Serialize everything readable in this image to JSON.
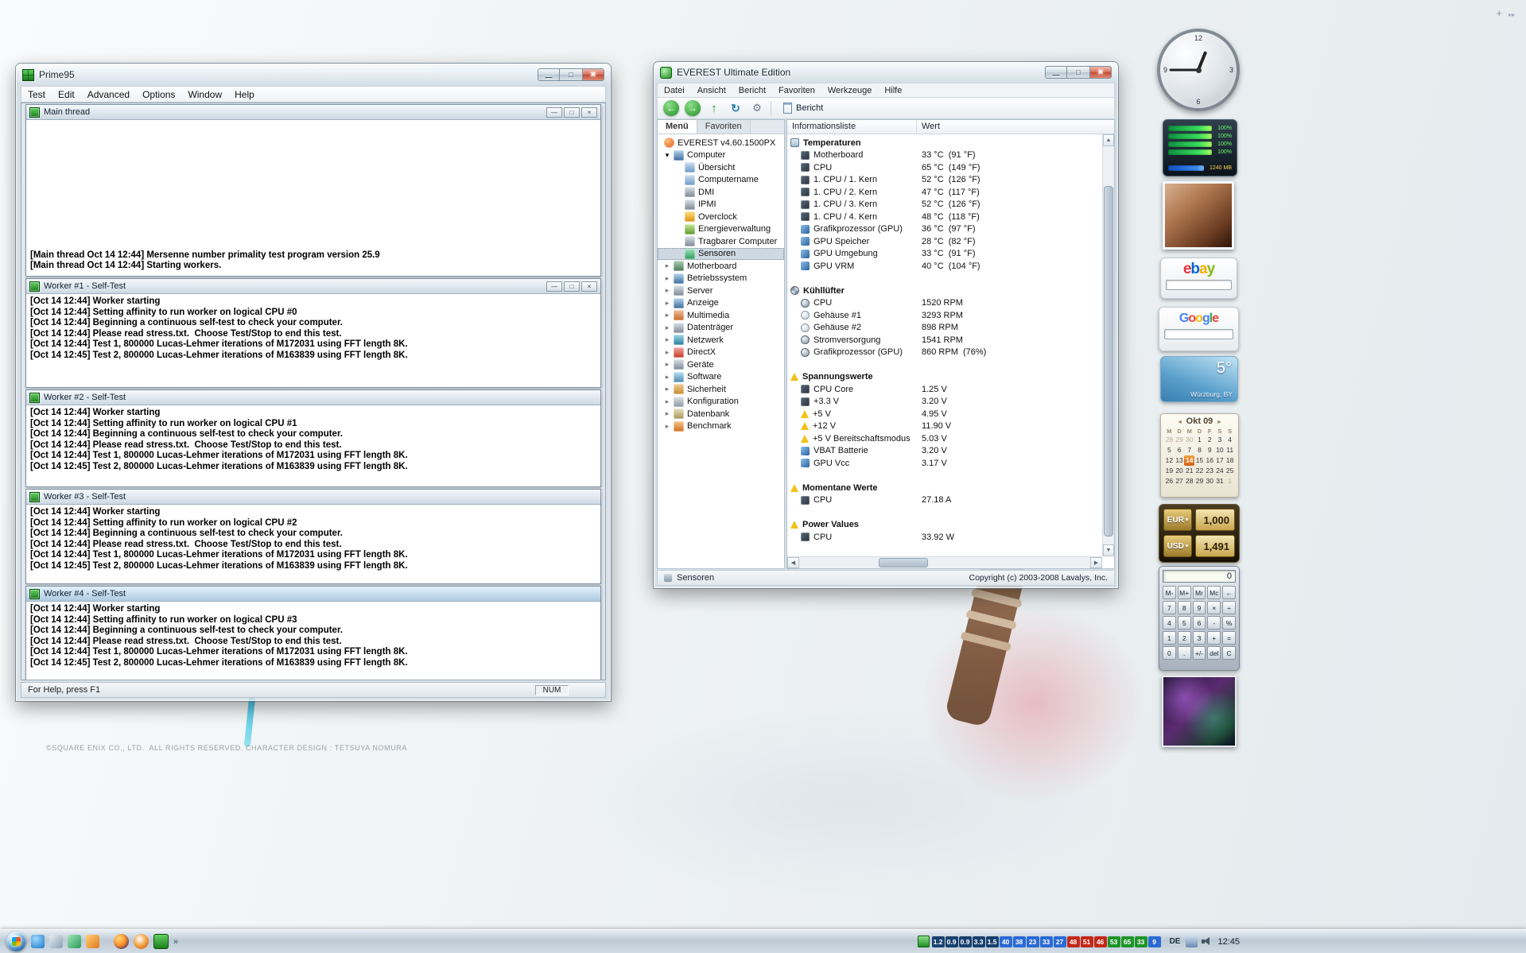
{
  "desktop": {
    "copyright": "©SQUARE ENIX CO., LTD.  ALL RIGHTS RESERVED. CHARACTER DESIGN : TETSUYA NOMURA"
  },
  "prime95": {
    "title": "Prime95",
    "menu": [
      "Test",
      "Edit",
      "Advanced",
      "Options",
      "Window",
      "Help"
    ],
    "status_help": "For Help, press F1",
    "status_num": "NUM",
    "main_thread": {
      "title": "Main thread",
      "lines": [
        "[Main thread Oct 14 12:44] Mersenne number primality test program version 25.9",
        "[Main thread Oct 14 12:44] Starting workers."
      ]
    },
    "worker1": {
      "title": "Worker #1 - Self-Test",
      "lines": [
        "[Oct 14 12:44] Worker starting",
        "[Oct 14 12:44] Setting affinity to run worker on logical CPU #0",
        "[Oct 14 12:44] Beginning a continuous self-test to check your computer.",
        "[Oct 14 12:44] Please read stress.txt.  Choose Test/Stop to end this test.",
        "[Oct 14 12:44] Test 1, 800000 Lucas-Lehmer iterations of M172031 using FFT length 8K.",
        "[Oct 14 12:45] Test 2, 800000 Lucas-Lehmer iterations of M163839 using FFT length 8K."
      ]
    },
    "worker2": {
      "title": "Worker #2 - Self-Test",
      "lines": [
        "[Oct 14 12:44] Worker starting",
        "[Oct 14 12:44] Setting affinity to run worker on logical CPU #1",
        "[Oct 14 12:44] Beginning a continuous self-test to check your computer.",
        "[Oct 14 12:44] Please read stress.txt.  Choose Test/Stop to end this test.",
        "[Oct 14 12:44] Test 1, 800000 Lucas-Lehmer iterations of M172031 using FFT length 8K.",
        "[Oct 14 12:45] Test 2, 800000 Lucas-Lehmer iterations of M163839 using FFT length 8K."
      ]
    },
    "worker3": {
      "title": "Worker #3 - Self-Test",
      "lines": [
        "[Oct 14 12:44] Worker starting",
        "[Oct 14 12:44] Setting affinity to run worker on logical CPU #2",
        "[Oct 14 12:44] Beginning a continuous self-test to check your computer.",
        "[Oct 14 12:44] Please read stress.txt.  Choose Test/Stop to end this test.",
        "[Oct 14 12:44] Test 1, 800000 Lucas-Lehmer iterations of M172031 using FFT length 8K.",
        "[Oct 14 12:45] Test 2, 800000 Lucas-Lehmer iterations of M163839 using FFT length 8K."
      ]
    },
    "worker4": {
      "title": "Worker #4 - Self-Test",
      "lines": [
        "[Oct 14 12:44] Worker starting",
        "[Oct 14 12:44] Setting affinity to run worker on logical CPU #3",
        "[Oct 14 12:44] Beginning a continuous self-test to check your computer.",
        "[Oct 14 12:44] Please read stress.txt.  Choose Test/Stop to end this test.",
        "[Oct 14 12:44] Test 1, 800000 Lucas-Lehmer iterations of M172031 using FFT length 8K.",
        "[Oct 14 12:45] Test 2, 800000 Lucas-Lehmer iterations of M163839 using FFT length 8K."
      ]
    }
  },
  "everest": {
    "title": "EVEREST Ultimate Edition",
    "menu": [
      "Datei",
      "Ansicht",
      "Bericht",
      "Favoriten",
      "Werkzeuge",
      "Hilfe"
    ],
    "report_button": "Bericht",
    "tabs": [
      {
        "label": "Menü",
        "active": true
      },
      {
        "label": "Favoriten",
        "active": false
      }
    ],
    "tree": [
      {
        "label": "EVEREST v4.60.1500PX",
        "icon": "everest-logo",
        "level": 0
      },
      {
        "label": "Computer",
        "icon": "computer",
        "level": 1,
        "arrow": "expanded"
      },
      {
        "label": "Übersicht",
        "icon": "overview",
        "level": 2
      },
      {
        "label": "Computername",
        "icon": "computername",
        "level": 2
      },
      {
        "label": "DMI",
        "icon": "dmi",
        "level": 2
      },
      {
        "label": "IPMI",
        "icon": "ipmi",
        "level": 2
      },
      {
        "label": "Overclock",
        "icon": "overclock",
        "level": 2
      },
      {
        "label": "Energieverwaltung",
        "icon": "power",
        "level": 2
      },
      {
        "label": "Tragbarer Computer",
        "icon": "portable",
        "level": 2
      },
      {
        "label": "Sensoren",
        "icon": "sensor",
        "level": 2,
        "selected": true
      },
      {
        "label": "Motherboard",
        "icon": "motherboard",
        "level": 1,
        "arrow": "collapsed"
      },
      {
        "label": "Betriebssystem",
        "icon": "os",
        "level": 1,
        "arrow": "collapsed"
      },
      {
        "label": "Server",
        "icon": "server",
        "level": 1,
        "arrow": "collapsed"
      },
      {
        "label": "Anzeige",
        "icon": "display",
        "level": 1,
        "arrow": "collapsed"
      },
      {
        "label": "Multimedia",
        "icon": "multimedia",
        "level": 1,
        "arrow": "collapsed"
      },
      {
        "label": "Datenträger",
        "icon": "storage",
        "level": 1,
        "arrow": "collapsed"
      },
      {
        "label": "Netzwerk",
        "icon": "network",
        "level": 1,
        "arrow": "collapsed"
      },
      {
        "label": "DirectX",
        "icon": "directx",
        "level": 1,
        "arrow": "collapsed"
      },
      {
        "label": "Geräte",
        "icon": "devices",
        "level": 1,
        "arrow": "collapsed"
      },
      {
        "label": "Software",
        "icon": "software",
        "level": 1,
        "arrow": "collapsed"
      },
      {
        "label": "Sicherheit",
        "icon": "security",
        "level": 1,
        "arrow": "collapsed"
      },
      {
        "label": "Konfiguration",
        "icon": "config",
        "level": 1,
        "arrow": "collapsed"
      },
      {
        "label": "Datenbank",
        "icon": "database",
        "level": 1,
        "arrow": "collapsed"
      },
      {
        "label": "Benchmark",
        "icon": "benchmark",
        "level": 1,
        "arrow": "collapsed"
      }
    ],
    "columns": {
      "info": "Informationsliste",
      "value": "Wert"
    },
    "rows": [
      {
        "type": "section",
        "icon": "sec-temp",
        "label": "Temperaturen"
      },
      {
        "type": "item",
        "icon": "chip-dark",
        "label": "Motherboard",
        "value": "33 °C  (91 °F)"
      },
      {
        "type": "item",
        "icon": "chip-dark",
        "label": "CPU",
        "value": "65 °C  (149 °F)"
      },
      {
        "type": "item",
        "icon": "chip-dark",
        "label": "1. CPU / 1. Kern",
        "value": "52 °C  (126 °F)"
      },
      {
        "type": "item",
        "icon": "chip-dark",
        "label": "1. CPU / 2. Kern",
        "value": "47 °C  (117 °F)"
      },
      {
        "type": "item",
        "icon": "chip-dark",
        "label": "1. CPU / 3. Kern",
        "value": "52 °C  (126 °F)"
      },
      {
        "type": "item",
        "icon": "chip-dark",
        "label": "1. CPU / 4. Kern",
        "value": "48 °C  (118 °F)"
      },
      {
        "type": "item",
        "icon": "gpu-blue",
        "label": "Grafikprozessor (GPU)",
        "value": "36 °C  (97 °F)"
      },
      {
        "type": "item",
        "icon": "gpu-blue",
        "label": "GPU Speicher",
        "value": "28 °C  (82 °F)"
      },
      {
        "type": "item",
        "icon": "gpu-blue",
        "label": "GPU Umgebung",
        "value": "33 °C  (91 °F)"
      },
      {
        "type": "item",
        "icon": "gpu-blue",
        "label": "GPU VRM",
        "value": "40 °C  (104 °F)"
      },
      {
        "type": "spacer"
      },
      {
        "type": "section",
        "icon": "sec-fan",
        "label": "Kühllüfter"
      },
      {
        "type": "item",
        "icon": "fan",
        "label": "CPU",
        "value": "1520 RPM"
      },
      {
        "type": "item",
        "icon": "fan-light",
        "label": "Gehäuse #1",
        "value": "3293 RPM"
      },
      {
        "type": "item",
        "icon": "fan-light",
        "label": "Gehäuse #2",
        "value": "898 RPM"
      },
      {
        "type": "item",
        "icon": "fan",
        "label": "Stromversorgung",
        "value": "1541 RPM"
      },
      {
        "type": "item",
        "icon": "fan",
        "label": "Grafikprozessor (GPU)",
        "value": "860 RPM  (76%)"
      },
      {
        "type": "spacer"
      },
      {
        "type": "section",
        "icon": "sec-volt",
        "label": "Spannungswerte"
      },
      {
        "type": "item",
        "icon": "chip-dark",
        "label": "CPU Core",
        "value": "1.25 V"
      },
      {
        "type": "item",
        "icon": "chip-dark",
        "label": "+3.3 V",
        "value": "3.20 V"
      },
      {
        "type": "item",
        "icon": "volt-warn",
        "label": "+5 V",
        "value": "4.95 V"
      },
      {
        "type": "item",
        "icon": "volt-warn",
        "label": "+12 V",
        "value": "11.90 V"
      },
      {
        "type": "item",
        "icon": "volt-warn",
        "label": "+5 V Bereitschaftsmodus",
        "value": "5.03 V"
      },
      {
        "type": "item",
        "icon": "gpu-blue",
        "label": "VBAT Batterie",
        "value": "3.20 V"
      },
      {
        "type": "item",
        "icon": "gpu-blue",
        "label": "GPU Vcc",
        "value": "3.17 V"
      },
      {
        "type": "spacer"
      },
      {
        "type": "section",
        "icon": "sec-volt",
        "label": "Momentane Werte"
      },
      {
        "type": "item",
        "icon": "chip-dark",
        "label": "CPU",
        "value": "27.18 A"
      },
      {
        "type": "spacer"
      },
      {
        "type": "section",
        "icon": "sec-volt",
        "label": "Power Values"
      },
      {
        "type": "item",
        "icon": "chip-dark",
        "label": "CPU",
        "value": "33.92 W"
      }
    ],
    "status_left": "Sensoren",
    "status_right": "Copyright (c) 2003-2008 Lavalys, Inc."
  },
  "gadgets": {
    "cpu_meter": {
      "core_labels": [
        "100%",
        "100%",
        "100%",
        "100%"
      ],
      "ram_label": "1240 MB"
    },
    "ebay": {
      "letters": [
        {
          "ch": "e",
          "color": "#e53238"
        },
        {
          "ch": "b",
          "color": "#0064d2"
        },
        {
          "ch": "a",
          "color": "#f5af02"
        },
        {
          "ch": "y",
          "color": "#86b817"
        }
      ]
    },
    "google": {
      "letters": [
        {
          "ch": "G",
          "color": "#4285f4"
        },
        {
          "ch": "o",
          "color": "#ea4335"
        },
        {
          "ch": "o",
          "color": "#fbbc05"
        },
        {
          "ch": "g",
          "color": "#4285f4"
        },
        {
          "ch": "l",
          "color": "#34a853"
        },
        {
          "ch": "e",
          "color": "#ea4335"
        }
      ]
    },
    "weather": {
      "temp": "5°",
      "location": "Würzburg, BY"
    },
    "calendar": {
      "title": "Okt 09",
      "day_headers": [
        "M",
        "D",
        "M",
        "D",
        "F",
        "S",
        "S"
      ],
      "cells": [
        {
          "d": "28",
          "m": true
        },
        {
          "d": "29",
          "m": true
        },
        {
          "d": "30",
          "m": true
        },
        {
          "d": "1"
        },
        {
          "d": "2"
        },
        {
          "d": "3"
        },
        {
          "d": "4"
        },
        {
          "d": "5"
        },
        {
          "d": "6"
        },
        {
          "d": "7"
        },
        {
          "d": "8"
        },
        {
          "d": "9"
        },
        {
          "d": "10"
        },
        {
          "d": "11"
        },
        {
          "d": "12"
        },
        {
          "d": "13"
        },
        {
          "d": "14",
          "today": true
        },
        {
          "d": "15"
        },
        {
          "d": "16"
        },
        {
          "d": "17"
        },
        {
          "d": "18"
        },
        {
          "d": "19"
        },
        {
          "d": "20"
        },
        {
          "d": "21"
        },
        {
          "d": "22"
        },
        {
          "d": "23"
        },
        {
          "d": "24"
        },
        {
          "d": "25"
        },
        {
          "d": "26"
        },
        {
          "d": "27"
        },
        {
          "d": "28"
        },
        {
          "d": "29"
        },
        {
          "d": "30"
        },
        {
          "d": "31"
        },
        {
          "d": "1",
          "m": true
        }
      ]
    },
    "currency": {
      "rows": [
        {
          "code": "EUR",
          "value": "1,000"
        },
        {
          "code": "USD",
          "value": "1,491"
        }
      ]
    },
    "calculator": {
      "display": "0",
      "buttons": [
        "M-",
        "M+",
        "Mr",
        "Mc",
        "←",
        "7",
        "8",
        "9",
        "×",
        "÷",
        "4",
        "5",
        "6",
        "-",
        "%",
        "1",
        "2",
        "3",
        "+",
        "=",
        "0",
        ".",
        "+/-",
        "del",
        "C"
      ]
    }
  },
  "taskbar": {
    "language": "DE",
    "clock": "12:45",
    "badges": [
      {
        "t": "1.2",
        "c": "navy"
      },
      {
        "t": "0.9",
        "c": "navy"
      },
      {
        "t": "0.9",
        "c": "navy"
      },
      {
        "t": "3.3",
        "c": "navy"
      },
      {
        "t": "1.5",
        "c": "navy"
      },
      {
        "t": "40",
        "c": "blue"
      },
      {
        "t": "38",
        "c": "blue"
      },
      {
        "t": "23",
        "c": "blue"
      },
      {
        "t": "33",
        "c": "blue"
      },
      {
        "t": "27",
        "c": "blue"
      },
      {
        "t": "48",
        "c": "red"
      },
      {
        "t": "51",
        "c": "red"
      },
      {
        "t": "46",
        "c": "red"
      },
      {
        "t": "53",
        "c": "green"
      },
      {
        "t": "65",
        "c": "green"
      },
      {
        "t": "33",
        "c": "green"
      },
      {
        "t": "9",
        "c": "blue"
      }
    ]
  }
}
